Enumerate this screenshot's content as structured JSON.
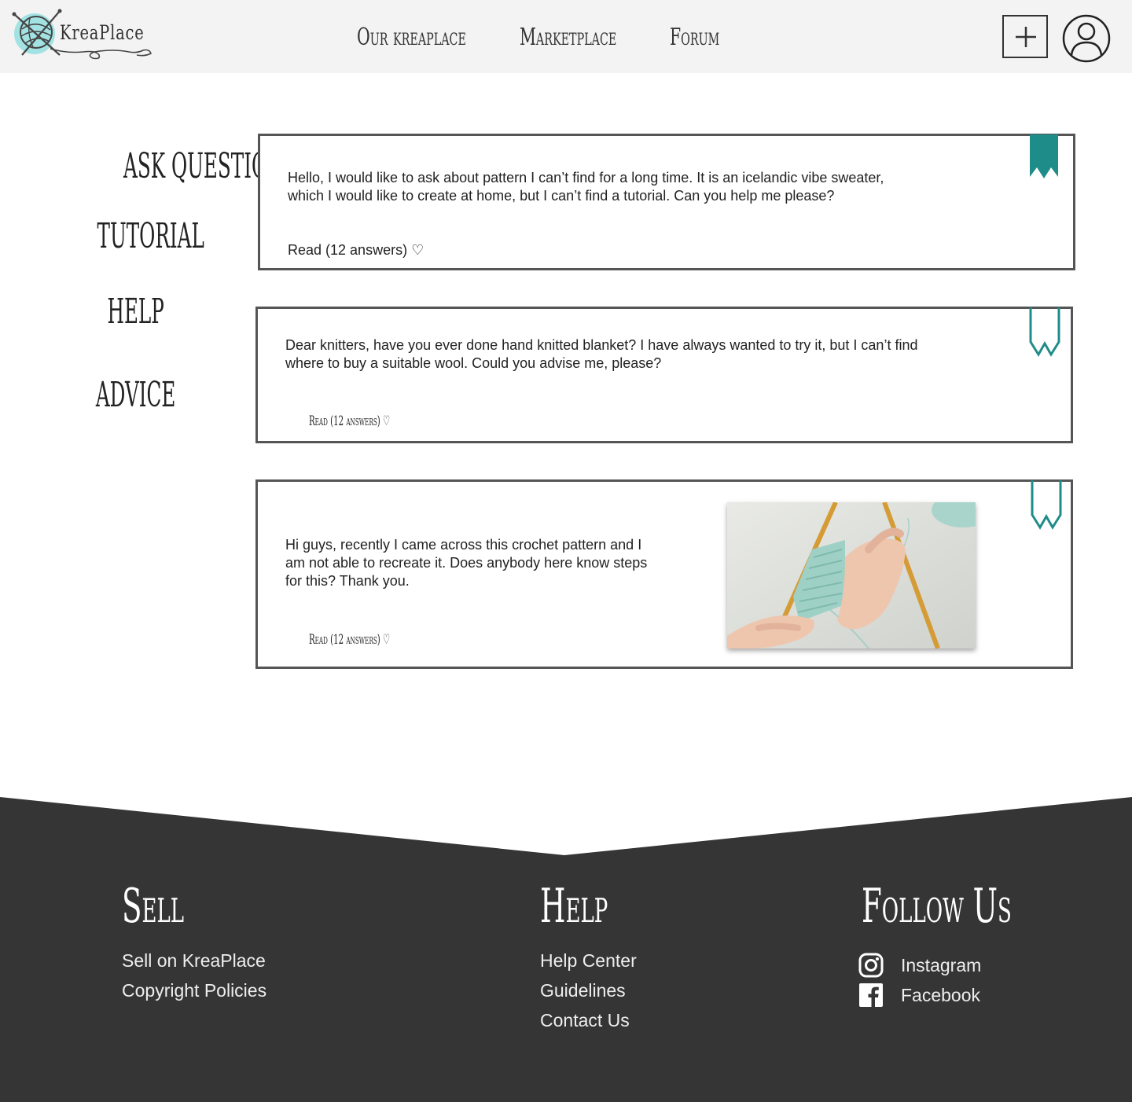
{
  "header": {
    "logo_text": "KreaPlace",
    "nav": [
      "Our kreaplace",
      "Marketplace",
      "Forum"
    ]
  },
  "sidebar": {
    "items": [
      "ASK QUESTIONS",
      "TUTORIAL",
      "HELP",
      "ADVICE"
    ]
  },
  "posts": [
    {
      "text_line1": "Hello, I would like to ask about pattern I can’t find for a long time. It is an icelandic vibe sweater,",
      "text_line2": "which  I would like to create at home, but I can’t find a tutorial. Can you help me please?",
      "read_label": "Read (12 answers) ♡",
      "bookmarked": true
    },
    {
      "text_line1": "Dear knitters, have you ever done hand knitted blanket? I have always wanted to try it, but I can’t find",
      "text_line2": "where to buy a suitable wool. Could you advise me, please?",
      "read_label": "Read (12 answers) ♡",
      "bookmarked": false
    },
    {
      "text_line1": "Hi guys, recently I came across this crochet pattern and I",
      "text_line2": "am not able to recreate it. Does anybody here know steps",
      "text_line3": "for this? Thank you.",
      "read_label": "Read (12 answers) ♡",
      "bookmarked": false,
      "image": "knitting-needles-photo"
    }
  ],
  "footer": {
    "sell": {
      "heading": "Sell",
      "links": [
        "Sell on KreaPlace",
        "Copyright Policies"
      ]
    },
    "help": {
      "heading": "Help",
      "links": [
        "Help Center",
        "Guidelines",
        "Contact Us"
      ]
    },
    "follow": {
      "heading": "Follow Us",
      "links": [
        "Instagram",
        "Facebook"
      ]
    }
  },
  "colors": {
    "accent": "#1e8c88",
    "footer_bg": "#353535",
    "header_bg": "#f3f3f3",
    "logo_blob": "#9fe0e2"
  },
  "icons": [
    "plus-icon",
    "user-avatar-icon",
    "bookmark-icon",
    "instagram-icon",
    "facebook-icon"
  ]
}
